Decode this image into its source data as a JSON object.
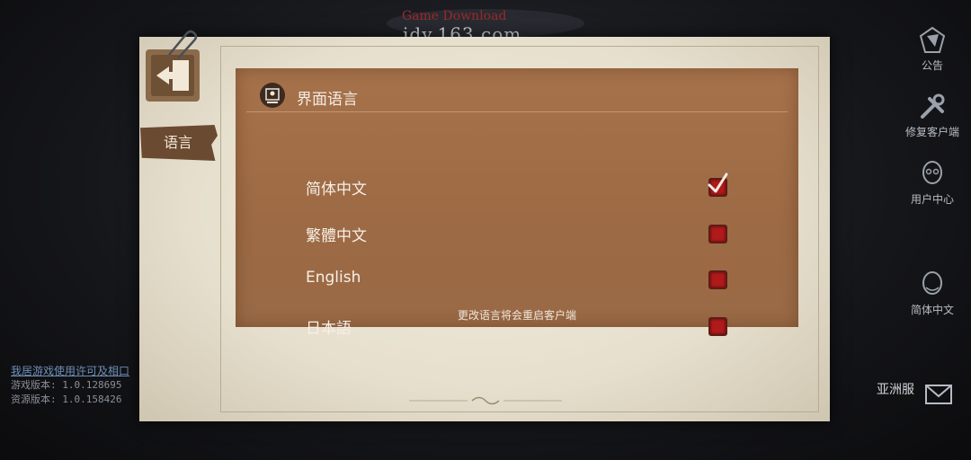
{
  "background": {
    "top_title": "Game Download",
    "top_url": "idv.163.com",
    "license_link": "我居游戏使用许可及相口",
    "game_version": "游戏版本: 1.0.128695",
    "resource_version": "资源版本: 1.0.158426"
  },
  "side_menu": {
    "items": [
      {
        "label": "公告",
        "icon": "announcement-icon"
      },
      {
        "label": "修复客户端",
        "icon": "repair-tools-icon"
      },
      {
        "label": "用户中心",
        "icon": "user-center-icon"
      },
      {
        "label": "简体中文",
        "icon": "language-icon"
      }
    ],
    "region_label": "亚洲服",
    "region_icon": "server-envelope-icon"
  },
  "dialog": {
    "tab_label": "语言",
    "section_title": "界面语言",
    "options": [
      {
        "label": "简体中文",
        "checked": true
      },
      {
        "label": "繁體中文",
        "checked": false
      },
      {
        "label": "English",
        "checked": false
      },
      {
        "label": "日本語",
        "checked": false
      }
    ],
    "notice": "更改语言将会重启客户端",
    "accent_color": "#9c6a44",
    "checkbox_color": "#b11a1a"
  }
}
